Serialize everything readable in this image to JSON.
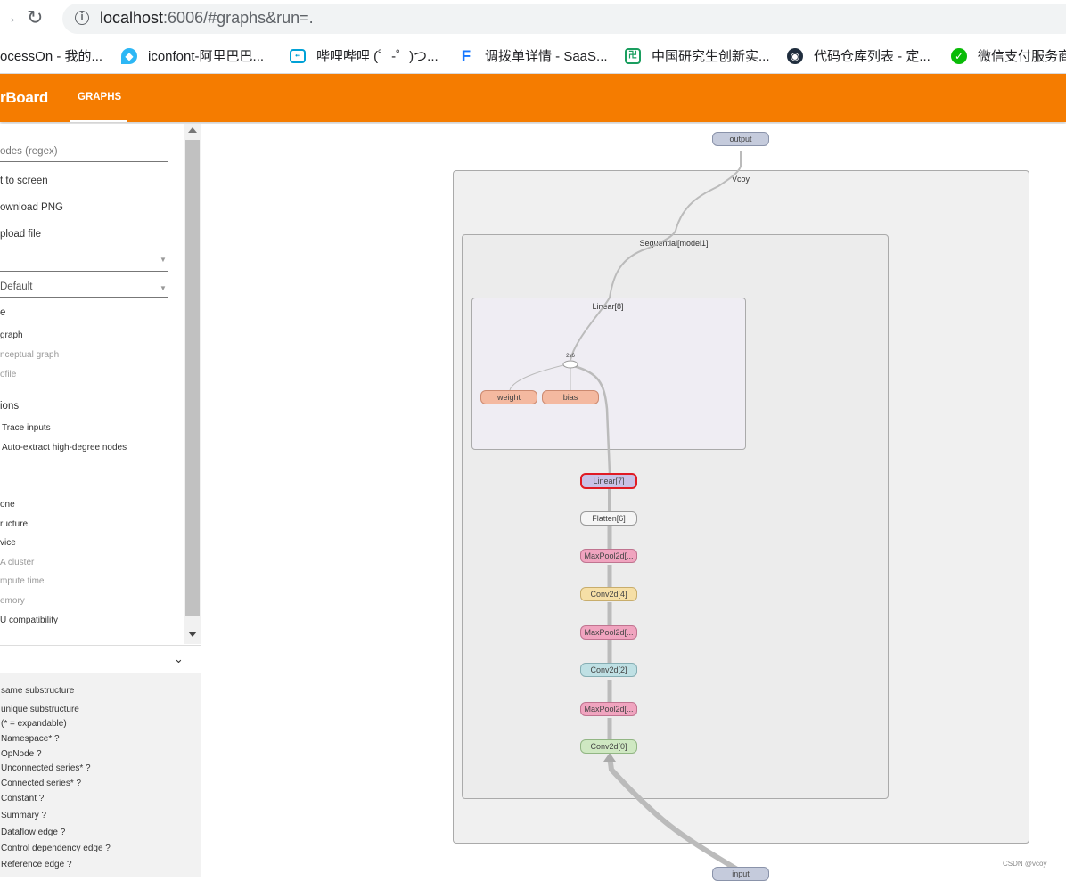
{
  "browser": {
    "url_host": "localhost",
    "url_rest": ":6006/#graphs&run=.",
    "bookmarks": [
      {
        "label": "ocessOn - 我的...",
        "icon": "processon-icon",
        "color": ""
      },
      {
        "label": "iconfont-阿里巴巴...",
        "icon": "iconfont-icon",
        "color": "#2db7f5"
      },
      {
        "label": "哔哩哔哩 (゜-゜)つ...",
        "icon": "bilibili-icon",
        "color": "#00a1d6"
      },
      {
        "label": "调拨单详情 - SaaS...",
        "icon": "saas-icon",
        "color": "#1677ff"
      },
      {
        "label": "中国研究生创新实...",
        "icon": "cpipc-icon",
        "color": "#1a9e5f"
      },
      {
        "label": "代码仓库列表 - 定...",
        "icon": "repo-icon",
        "color": "#1f2d3d"
      },
      {
        "label": "微信支付服务商",
        "icon": "wechat-pay-icon",
        "color": "#09bb07"
      }
    ]
  },
  "header": {
    "title": "rBoard",
    "tab_graphs": "GRAPHS",
    "color": "#f57c00"
  },
  "sidebar": {
    "search_placeholder": "odes (regex)",
    "fit_to_screen": "t to screen",
    "download_png": "ownload PNG",
    "upload_file": "pload file",
    "tag_value": "Default",
    "graph_type_heading": "e",
    "graph_type_options": [
      "graph",
      "nceptual graph",
      "ofile"
    ],
    "node_options_heading": "ions",
    "trace_inputs": "Trace inputs",
    "auto_extract": "Auto-extract high-degree nodes",
    "color_options": [
      "one",
      "ructure",
      "vice",
      "A cluster",
      "mpute time",
      "emory",
      "U compatibility"
    ],
    "legend": {
      "same_substructure": "same substructure",
      "unique_substructure": "unique substructure",
      "expandable_note": "(* = expandable)",
      "items": [
        "Namespace* ?",
        "OpNode ?",
        "Unconnected series* ?",
        "Connected series* ?",
        "Constant ?",
        "Summary ?",
        "Dataflow edge ?",
        "Control dependency edge ?",
        "Reference edge ?"
      ]
    }
  },
  "graph": {
    "outer_cluster": "Vcoy",
    "middle_cluster": "Sequential[model1]",
    "inner_cluster": "Linear[8]",
    "op_label": "2x6",
    "nodes": {
      "output": "output",
      "input": "input",
      "weight": "weight",
      "bias": "bias",
      "linear7": "Linear[7]",
      "flatten6": "Flatten[6]",
      "maxpool5": "MaxPool2d[...",
      "conv4": "Conv2d[4]",
      "maxpool3": "MaxPool2d[...",
      "conv2": "Conv2d[2]",
      "maxpool1": "MaxPool2d[...",
      "conv0": "Conv2d[0]"
    },
    "colors": {
      "io": "#c5cbdc",
      "param": "#f4b9a0",
      "linear": "#c9c2e6",
      "flatten": "#f5f5f5",
      "maxpool": "#f0a4bf",
      "conv_yellow": "#f6dfa6",
      "conv_blue": "#bfe0e4",
      "conv_green": "#cfe8c2",
      "selected_border": "#e01b24"
    }
  },
  "watermark": "CSDN @vcoy"
}
